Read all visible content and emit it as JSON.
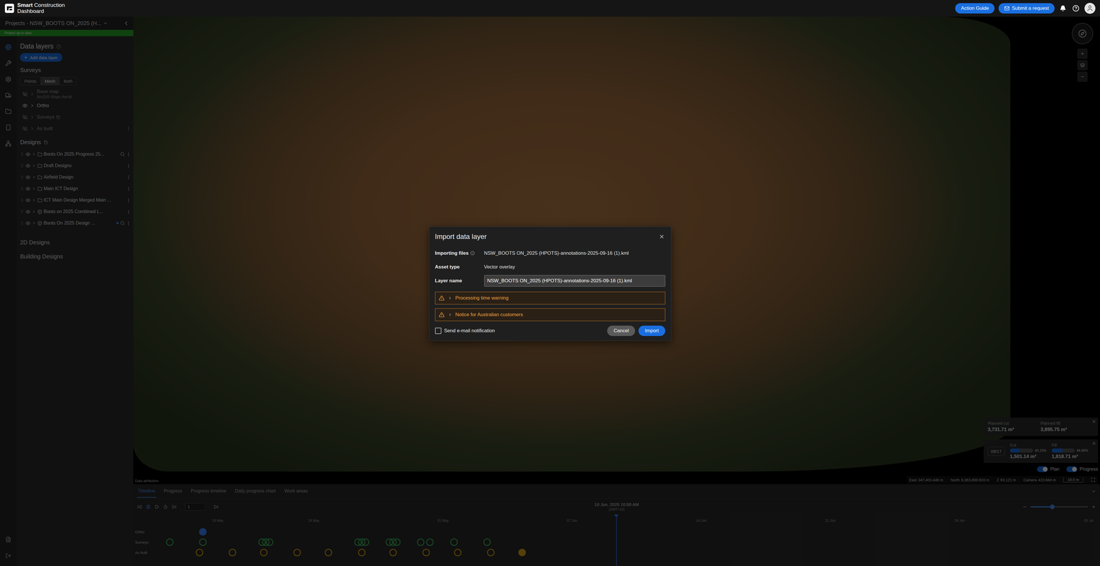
{
  "header": {
    "logo": {
      "bold": "Smart",
      "light": "Construction",
      "second_line": "Dashboard"
    },
    "actions": [
      {
        "label": "Action Guide",
        "kind": "plain"
      },
      {
        "label": "Submit a request",
        "kind": "mail"
      }
    ]
  },
  "sidebar": {
    "project_title": "Projects - NSW_BOOTS ON_2025 (H...",
    "status": "Project up to date",
    "rail": [
      {
        "selected": true
      },
      {
        "selected": false
      },
      {
        "selected": false
      },
      {
        "selected": false
      },
      {
        "selected": false
      },
      {
        "selected": false
      },
      {
        "selected": false
      }
    ],
    "data_layers_title": "Data layers",
    "add_button": "Add data layer",
    "surveys_title": "Surveys",
    "segments": [
      {
        "label": "Points",
        "selected": false
      },
      {
        "label": "Mesh",
        "selected": true
      },
      {
        "label": "Both",
        "selected": false
      }
    ],
    "layers": [
      {
        "name": "Base map",
        "subtitle": "ArcGIS Maps Aerial",
        "visible": false,
        "history": false,
        "menu": false
      },
      {
        "name": "Ortho",
        "subtitle": "",
        "visible": true,
        "history": false,
        "menu": false
      },
      {
        "name": "Surveys",
        "subtitle": "",
        "visible": false,
        "history": true,
        "menu": false
      },
      {
        "name": "As built",
        "subtitle": "",
        "visible": false,
        "history": false,
        "menu": true
      }
    ],
    "designs_title": "Designs",
    "designs": [
      {
        "name": "Boots On 2025 Progress 25...",
        "kind": "folder",
        "zoomable": true,
        "active": false
      },
      {
        "name": "Draft Designs",
        "kind": "folder",
        "zoomable": false,
        "active": false
      },
      {
        "name": "Airfield Design",
        "kind": "folder",
        "zoomable": false,
        "active": false
      },
      {
        "name": "Main ICT Design",
        "kind": "folder",
        "zoomable": false,
        "active": false
      },
      {
        "name": "ICT Main Design Merged Main ...",
        "kind": "folder",
        "zoomable": false,
        "active": false
      },
      {
        "name": "Boots on 2025 Combined L...",
        "kind": "design",
        "zoomable": false,
        "active": false
      },
      {
        "name": "Boots On 2025 Design ...",
        "kind": "design",
        "zoomable": true,
        "active": true
      }
    ],
    "sections": [
      "2D Designs",
      "Building Designs"
    ]
  },
  "map": {
    "attribution": "Data attribution",
    "coordinates": [
      {
        "label": "East",
        "value": "347,403.446 m"
      },
      {
        "label": "North",
        "value": "6,363,898.633 m"
      },
      {
        "label": "Z",
        "value": "93.121 m"
      },
      {
        "label": "Camera",
        "value": "423.684 m"
      }
    ],
    "scale": "10.0 m",
    "planned": [
      {
        "label": "Planned cut",
        "value": "3,731.71 m³"
      },
      {
        "label": "Planned fill",
        "value": "3,895.75 m³"
      }
    ],
    "progress_date": "09/17",
    "progress": [
      {
        "label": "Cut",
        "percent": "40.23%",
        "value": "1,501.14 m³",
        "level": 0.4023
      },
      {
        "label": "Fill",
        "percent": "46.68%",
        "value": "1,818.71 m³",
        "level": 0.4668
      }
    ],
    "toggles": [
      {
        "label": "Plan",
        "on": true
      },
      {
        "label": "Progress",
        "on": true
      }
    ]
  },
  "timeline": {
    "tabs": [
      {
        "label": "Timeline",
        "selected": true
      },
      {
        "label": "Progress",
        "selected": false
      },
      {
        "label": "Progress timeline",
        "selected": false
      },
      {
        "label": "Daily progress chart",
        "selected": false
      },
      {
        "label": "Work areas",
        "selected": false
      }
    ],
    "frame": "1",
    "date": "10 Jun, 2025 10:00 AM",
    "timezone": "(GMT+10)",
    "zoom_level": 0.38,
    "axis": {
      "start": 0,
      "end": 51.5,
      "current": 25.6,
      "ticks": [
        {
          "day": 4,
          "label": "19 May"
        },
        {
          "day": 9.2,
          "label": "24 May"
        },
        {
          "day": 16.2,
          "label": "31 May"
        },
        {
          "day": 23.2,
          "label": "07 Jun"
        },
        {
          "day": 30.2,
          "label": "14 Jun"
        },
        {
          "day": 37.2,
          "label": "21 Jun"
        },
        {
          "day": 44.2,
          "label": "28 Jun"
        },
        {
          "day": 51.2,
          "label": "05 Jul"
        }
      ]
    },
    "rows": [
      {
        "label": "Ortho",
        "color": "#3b82f6",
        "events": [
          {
            "day": 3.2,
            "selected": true
          }
        ]
      },
      {
        "label": "Surveys",
        "color": "#3fae5a",
        "events": [
          {
            "day": 1.4,
            "selected": false
          },
          {
            "day": 3.2,
            "selected": false
          },
          {
            "day": 6.4,
            "selected": false
          },
          {
            "day": 6.6,
            "selected": false
          },
          {
            "day": 6.8,
            "selected": false
          },
          {
            "day": 11.6,
            "selected": false
          },
          {
            "day": 11.8,
            "selected": false
          },
          {
            "day": 12.0,
            "selected": false
          },
          {
            "day": 13.3,
            "selected": false
          },
          {
            "day": 13.5,
            "selected": false
          },
          {
            "day": 13.7,
            "selected": false
          },
          {
            "day": 15.0,
            "selected": false
          },
          {
            "day": 15.5,
            "selected": false
          },
          {
            "day": 16.8,
            "selected": false
          },
          {
            "day": 18.6,
            "selected": false
          }
        ]
      },
      {
        "label": "As built",
        "color": "#d4a017",
        "events": [
          {
            "day": 3.0,
            "selected": false
          },
          {
            "day": 4.8,
            "selected": false
          },
          {
            "day": 6.5,
            "selected": false
          },
          {
            "day": 8.3,
            "selected": false
          },
          {
            "day": 10.0,
            "selected": false
          },
          {
            "day": 11.8,
            "selected": false
          },
          {
            "day": 13.5,
            "selected": false
          },
          {
            "day": 15.3,
            "selected": false
          },
          {
            "day": 17.0,
            "selected": false
          },
          {
            "day": 18.8,
            "selected": false
          },
          {
            "day": 20.5,
            "selected": true
          }
        ]
      }
    ]
  },
  "modal": {
    "title": "Import data layer",
    "fields": [
      {
        "label": "Importing files",
        "info": true,
        "value": "NSW_BOOTS ON_2025 (HPOTS)-annotations-2025-09-16 (1).kml",
        "kind": "text"
      },
      {
        "label": "Asset type",
        "info": false,
        "value": "Vector overlay",
        "kind": "text"
      },
      {
        "label": "Layer name",
        "info": false,
        "value": "NSW_BOOTS ON_2025 (HPOTS)-annotations-2025-09-16 (1).kml",
        "kind": "input"
      }
    ],
    "warnings": [
      {
        "label": "Processing time warning",
        "expanded": false
      },
      {
        "label": "Notice for Australian customers",
        "expanded": false
      }
    ],
    "checkbox": {
      "label": "Send e-mail notification",
      "checked": false
    },
    "buttons": [
      {
        "label": "Cancel",
        "kind": "secondary"
      },
      {
        "label": "Import",
        "kind": "primary"
      }
    ]
  }
}
